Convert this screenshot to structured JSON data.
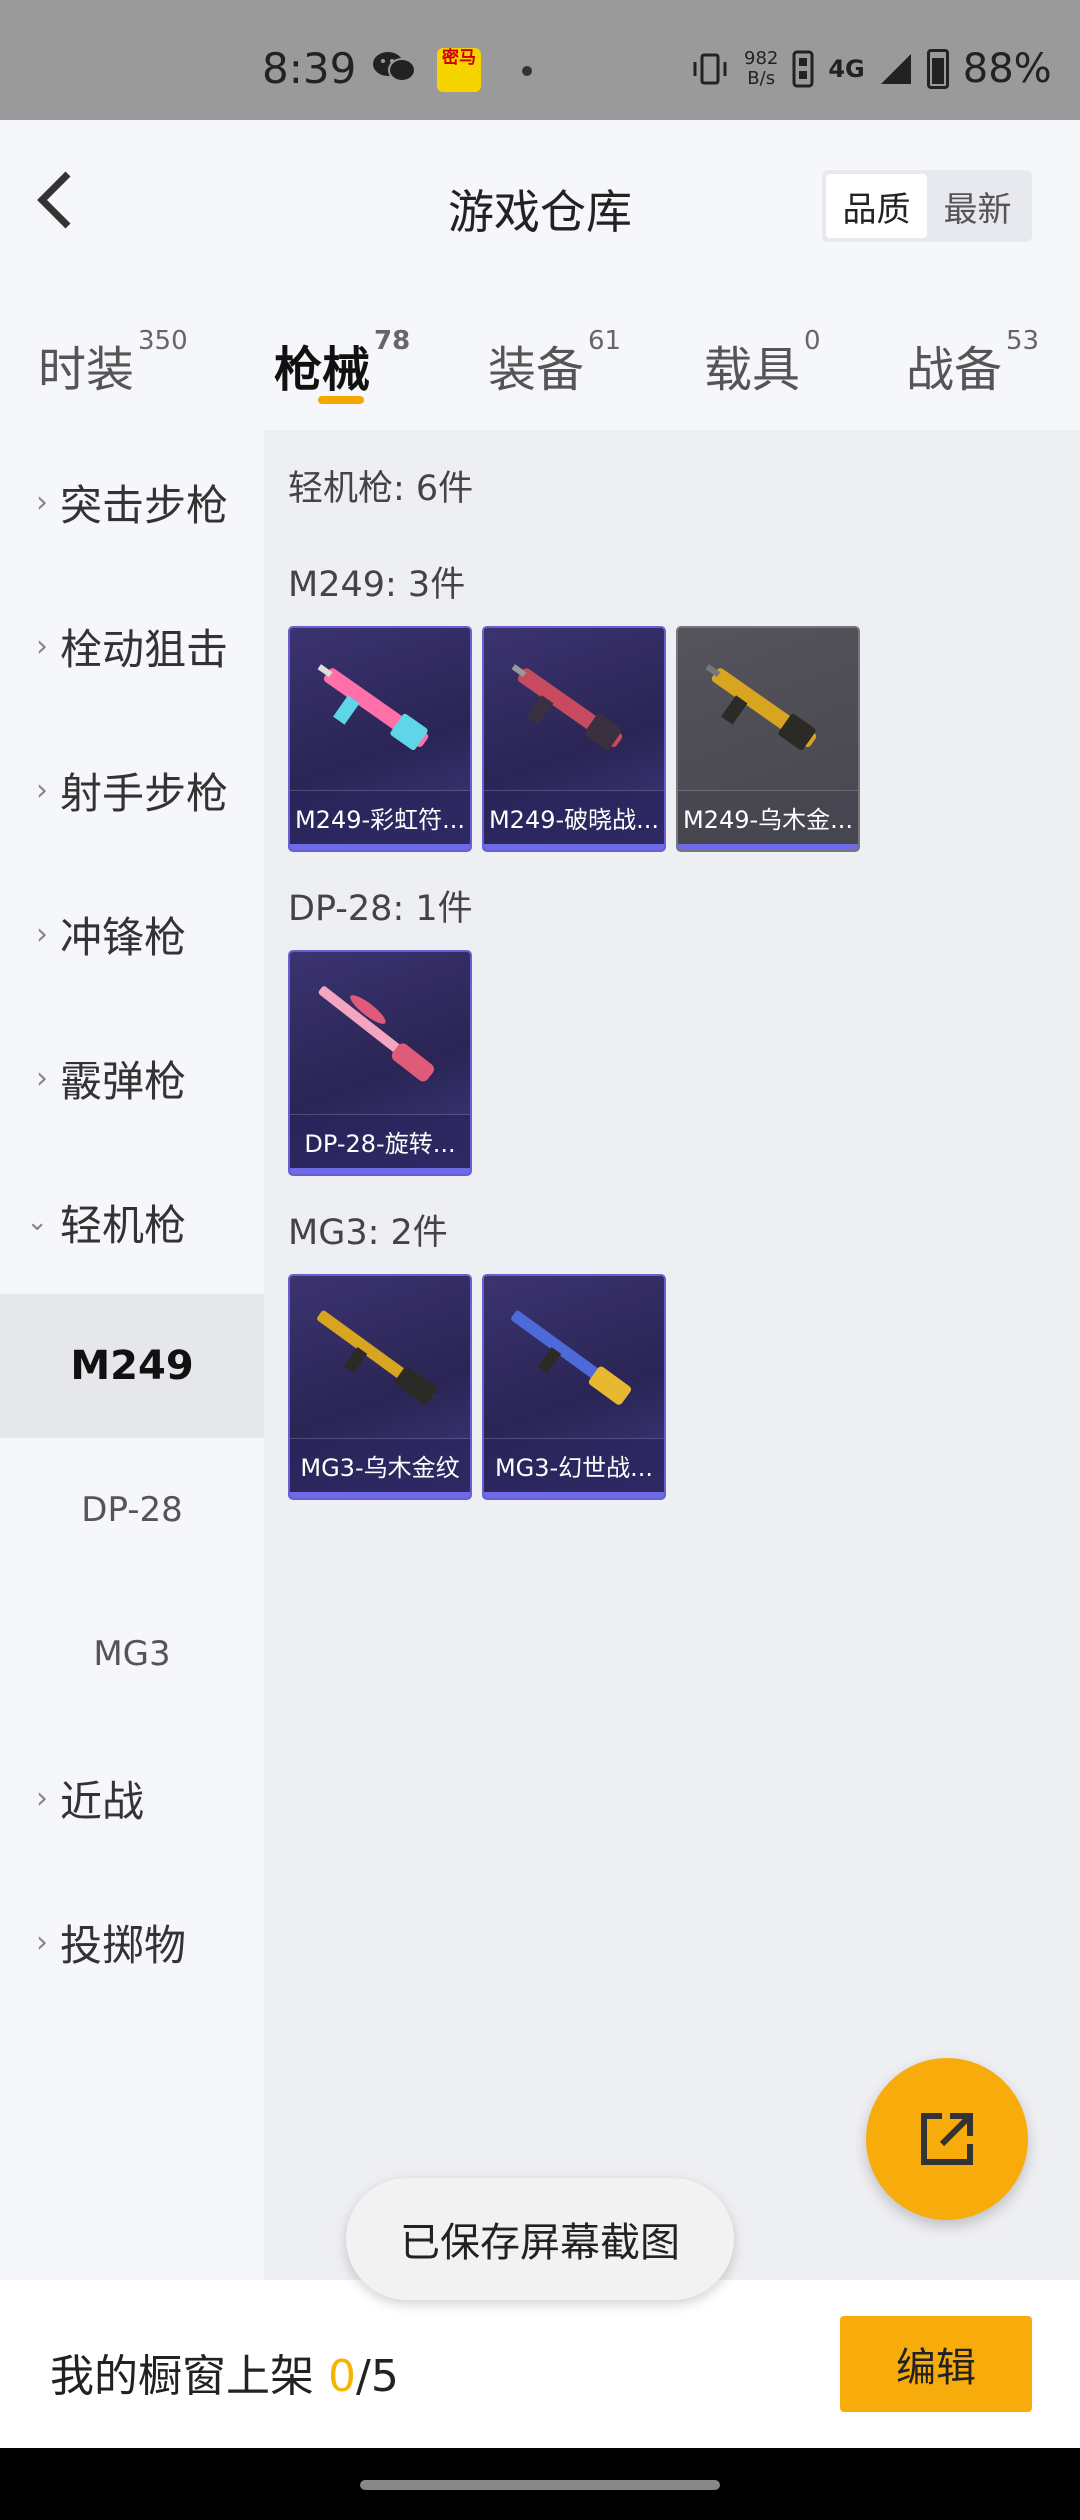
{
  "status_bar": {
    "time": "8:39",
    "app_icon_text": "密马",
    "net_speed_value": "982",
    "net_speed_unit": "B/s",
    "network": "4G",
    "battery": "88%"
  },
  "header": {
    "title": "游戏仓库",
    "sort_options": [
      "品质",
      "最新"
    ],
    "sort_selected": "品质"
  },
  "tabs": [
    {
      "label": "时装",
      "count": "350"
    },
    {
      "label": "枪械",
      "count": "78"
    },
    {
      "label": "装备",
      "count": "61"
    },
    {
      "label": "载具",
      "count": "0"
    },
    {
      "label": "战备",
      "count": "53"
    }
  ],
  "active_tab": "枪械",
  "sidebar": {
    "categories": [
      "突击步枪",
      "栓动狙击",
      "射手步枪",
      "冲锋枪",
      "霰弹枪",
      "轻机枪",
      "近战",
      "投掷物"
    ],
    "expanded": "轻机枪",
    "sub_items": [
      "M249",
      "DP-28",
      "MG3"
    ],
    "selected_sub": "M249"
  },
  "content": {
    "summary": "轻机枪: 6件",
    "groups": [
      {
        "title": "M249: 3件",
        "items": [
          {
            "label": "M249-彩虹符...",
            "quality": "purple",
            "colors": [
              "#ff6fa8",
              "#5fd6e8"
            ]
          },
          {
            "label": "M249-破晓战...",
            "quality": "purple",
            "colors": [
              "#c84a5e",
              "#3a3040"
            ]
          },
          {
            "label": "M249-乌木金...",
            "quality": "gray",
            "colors": [
              "#d9a520",
              "#2c2a26"
            ]
          }
        ]
      },
      {
        "title": "DP-28: 1件",
        "items": [
          {
            "label": "DP-28-旋转...",
            "quality": "purple",
            "colors": [
              "#f4a6c0",
              "#e05a7a"
            ]
          }
        ]
      },
      {
        "title": "MG3: 2件",
        "items": [
          {
            "label": "MG3-乌木金纹",
            "quality": "purple",
            "colors": [
              "#d9a520",
              "#2c2a26"
            ]
          },
          {
            "label": "MG3-幻世战...",
            "quality": "purple",
            "colors": [
              "#4d6ad8",
              "#e8b830"
            ]
          }
        ]
      }
    ]
  },
  "toast": "已保存屏幕截图",
  "bottom_bar": {
    "label": "我的橱窗上架",
    "count_current": "0",
    "count_sep_total": "/5",
    "edit_button": "编辑"
  },
  "colors": {
    "accent": "#f8ac0c",
    "purple_border": "#6a5fd0"
  }
}
